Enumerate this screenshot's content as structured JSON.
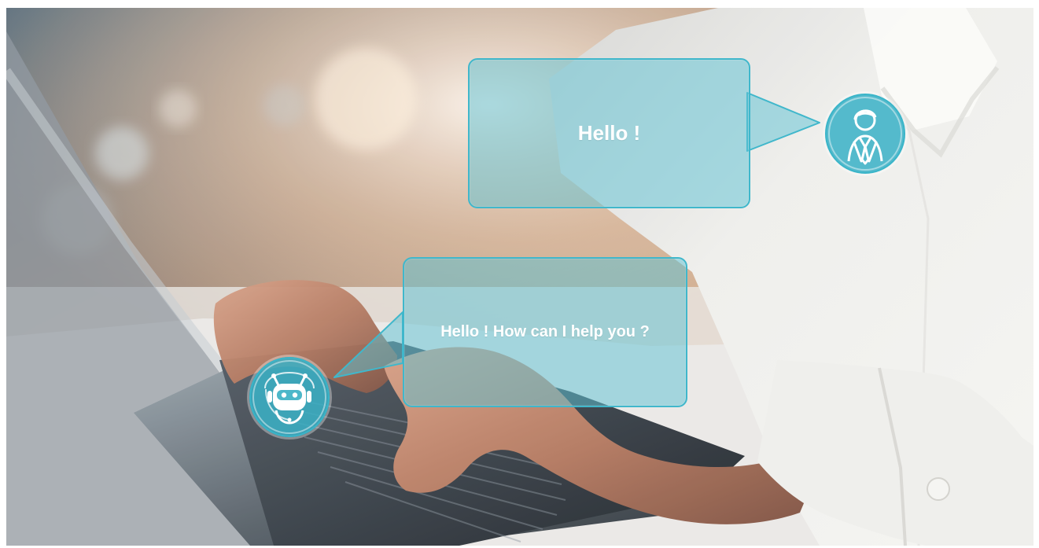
{
  "chat": {
    "user_message": "Hello !",
    "bot_message": "Hello ! How can I help you ?"
  },
  "colors": {
    "bubble_fill": "#5cc2d3",
    "bubble_border": "#40b7cb",
    "avatar_fill": "#3ab1c6",
    "text": "#ffffff"
  },
  "icons": {
    "user": "businessman-avatar-icon",
    "bot": "chatbot-robot-icon"
  }
}
